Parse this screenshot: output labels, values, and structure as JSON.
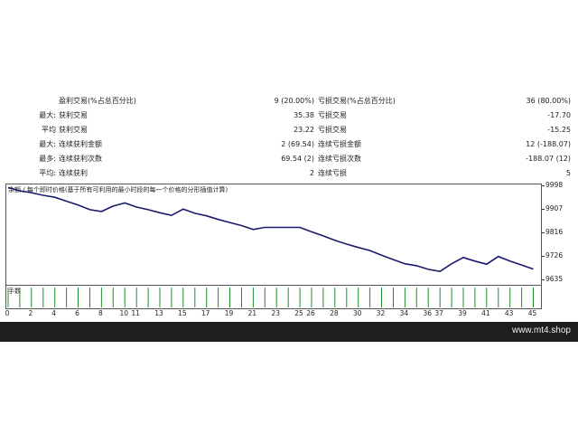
{
  "stats": {
    "rows": [
      {
        "left_prefix": "",
        "left_label": "盈利交易(%占总百分比)",
        "left_value": "9 (20.00%)",
        "right_label": "亏损交易(%占总百分比)",
        "right_value": "36 (80.00%)"
      },
      {
        "left_prefix": "最大:",
        "left_label": "获利交易",
        "left_value": "35.38",
        "right_label": "亏损交易",
        "right_value": "-17.70"
      },
      {
        "left_prefix": "平均",
        "left_label": "获利交易",
        "left_value": "23.22",
        "right_label": "亏损交易",
        "right_value": "-15.25"
      },
      {
        "left_prefix": "最大:",
        "left_label": "连续获利金额",
        "left_value": "2 (69.54)",
        "right_label": "连续亏损金额",
        "right_value": "12 (-188.07)"
      },
      {
        "left_prefix": "最多:",
        "left_label": "连续获利次数",
        "left_value": "69.54 (2)",
        "right_label": "连续亏损次数",
        "right_value": "-188.07 (12)"
      },
      {
        "left_prefix": "平均:",
        "left_label": "连续获利",
        "left_value": "2",
        "right_label": "连续亏损",
        "right_value": "5"
      }
    ]
  },
  "chart": {
    "legend_marker_1": "余额",
    "legend_marker_2": "/",
    "title": "每个即时价格(基于所有可利用的最小时段的每一个价格的分形插值计算)",
    "volume_label": "手数",
    "line_color": "#1a1a6e",
    "bar_color": "#1f8f2e"
  },
  "chart_data": {
    "type": "line",
    "title": "",
    "xlabel": "",
    "ylabel": "",
    "x_ticks": [
      "0",
      "2",
      "4",
      "6",
      "8",
      "10",
      "11",
      "13",
      "15",
      "17",
      "19",
      "21",
      "23",
      "25",
      "26",
      "28",
      "30",
      "32",
      "34",
      "36",
      "37",
      "39",
      "41",
      "43",
      "45"
    ],
    "y_ticks": [
      "9998",
      "9907",
      "9816",
      "9726",
      "9635"
    ],
    "ylim": [
      9620,
      10010
    ],
    "xlim": [
      0,
      45.5
    ],
    "series": [
      {
        "x": [
          0,
          1,
          2,
          3,
          4,
          5,
          6,
          7,
          8,
          9,
          10,
          11,
          12,
          13,
          14,
          15,
          16,
          17,
          18,
          19,
          20,
          21,
          22,
          23,
          24,
          25,
          26,
          27,
          28,
          29,
          30,
          31,
          32,
          33,
          34,
          35,
          36,
          37,
          38,
          39,
          40,
          41,
          42,
          43,
          44,
          45
        ],
        "values": [
          9998,
          9985,
          9978,
          9968,
          9960,
          9945,
          9930,
          9912,
          9905,
          9926,
          9938,
          9922,
          9912,
          9900,
          9890,
          9914,
          9898,
          9888,
          9874,
          9862,
          9850,
          9835,
          9843,
          9843,
          9843,
          9843,
          9826,
          9810,
          9793,
          9778,
          9765,
          9753,
          9735,
          9718,
          9702,
          9694,
          9680,
          9672,
          9702,
          9726,
          9712,
          9700,
          9730,
          9712,
          9697,
          9681
        ]
      }
    ],
    "volume": [
      1,
      1,
      1,
      1,
      1,
      1,
      1,
      1,
      1,
      1,
      1,
      1,
      1,
      1,
      1,
      1,
      1,
      1,
      1,
      1,
      1,
      1,
      1,
      1,
      1,
      1,
      1,
      1,
      1,
      1,
      1,
      1,
      1,
      1,
      1,
      1,
      1,
      1,
      1,
      1,
      1,
      1,
      1,
      1,
      1,
      1
    ]
  },
  "footer": {
    "site": "www.mt4.shop"
  }
}
